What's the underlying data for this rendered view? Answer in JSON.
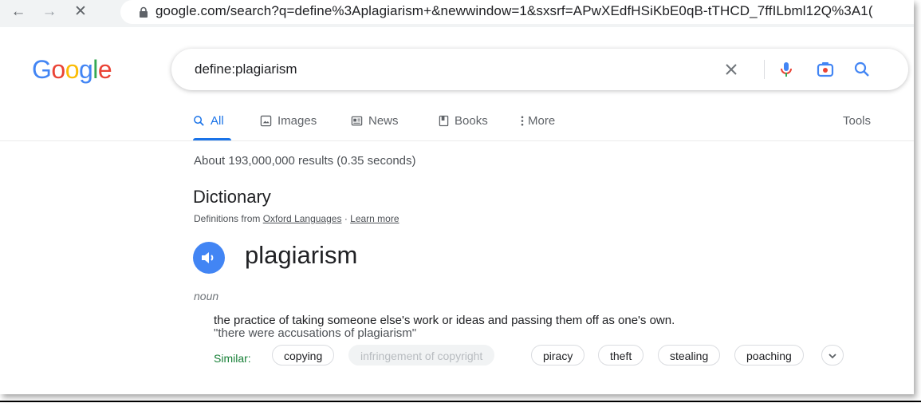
{
  "browser": {
    "url": "google.com/search?q=define%3Aplagiarism+&newwindow=1&sxsrf=APwXEdfHSiKbE0qB-tTHCD_7ffILbml12Q%3A1("
  },
  "header": {
    "logo": "Google",
    "logo_colors": [
      "#4285f4",
      "#ea4335",
      "#fbbc05",
      "#4285f4",
      "#34a853",
      "#ea4335"
    ],
    "query": "define:plagiarism"
  },
  "tabs": [
    {
      "label": "All",
      "icon": "search-icon",
      "active": true
    },
    {
      "label": "Images",
      "icon": "image-icon",
      "active": false
    },
    {
      "label": "News",
      "icon": "news-icon",
      "active": false
    },
    {
      "label": "Books",
      "icon": "book-icon",
      "active": false
    },
    {
      "label": "More",
      "icon": "more-vert-icon",
      "active": false
    }
  ],
  "tools_label": "Tools",
  "result_stats": "About 193,000,000 results (0.35 seconds)",
  "dictionary": {
    "title": "Dictionary",
    "source_prefix": "Definitions from",
    "source_link": "Oxford Languages",
    "separator": "·",
    "learn_more": "Learn more",
    "word": "plagiarism",
    "part_of_speech": "noun",
    "definition": "the practice of taking someone else's work or ideas and passing them off as one's own.",
    "example": "\"there were accusations of plagiarism\"",
    "similar_label": "Similar:",
    "similar": [
      "copying",
      "infringement of copyright",
      "piracy",
      "theft",
      "stealing",
      "poaching"
    ]
  },
  "colors": {
    "accent": "#1a73e8",
    "speaker": "#4285f4",
    "similar_label": "#188038"
  }
}
